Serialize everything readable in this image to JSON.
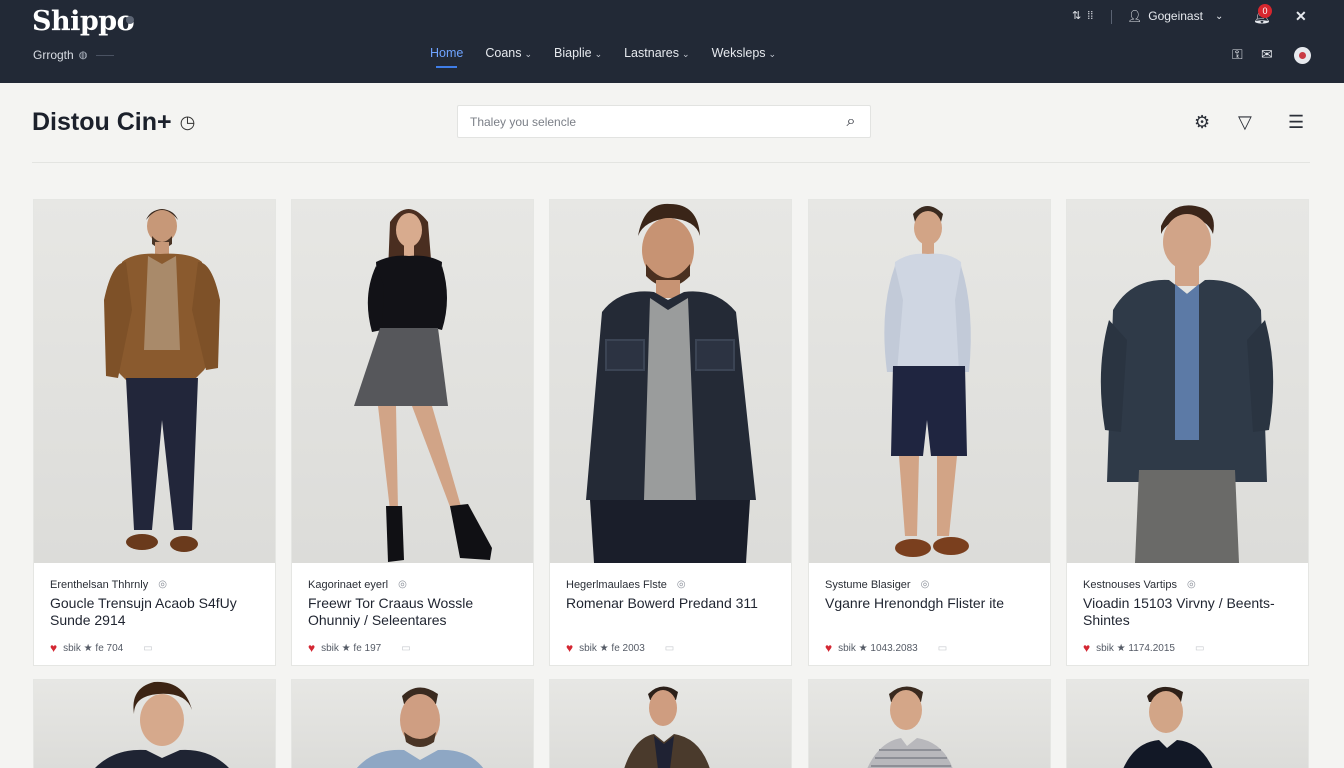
{
  "app": {
    "logo": "Shippo",
    "location": "Grrogth"
  },
  "nav": {
    "items": [
      {
        "label": "Home",
        "active": true
      },
      {
        "label": "Coans",
        "chevron": true
      },
      {
        "label": "Biaplie",
        "chevron": true
      },
      {
        "label": "Lastnares",
        "chevron": true
      },
      {
        "label": "Weksleps",
        "chevron": true
      }
    ]
  },
  "topright": {
    "user": "Gogeinast",
    "notifications": "0"
  },
  "header": {
    "title": "Distou Cin+",
    "search_placeholder": "Thaley you selencle"
  },
  "products": [
    {
      "brand": "Erenthelsan Thhrnly",
      "name": "Goucle Trensujn Acaob S4fUy Sunde 2914",
      "meta": "sbik ★ fe 704"
    },
    {
      "brand": "Kagorinaet eyerl",
      "name": "Freewr Tor Craaus Wossle Ohunniy / Seleentares",
      "meta": "sbik ★ fe 197"
    },
    {
      "brand": "Hegerlmaulaes Flste",
      "name": "Romenar Bowerd Predand 311",
      "meta": "sbik ★ fe 2003"
    },
    {
      "brand": "Systume Blasiger",
      "name": "Vganre Hrenondgh Flister ite",
      "meta": "sbik ★ 1043.2083"
    },
    {
      "brand": "Kestnouses Vartips",
      "name": "Vioadin 15103 Virvny / Beents-Shintes",
      "meta": "sbik ★ 1174.2015"
    }
  ],
  "colors": {
    "nav_bg": "#222936",
    "accent": "#3f7de8",
    "heart": "#d42733"
  }
}
